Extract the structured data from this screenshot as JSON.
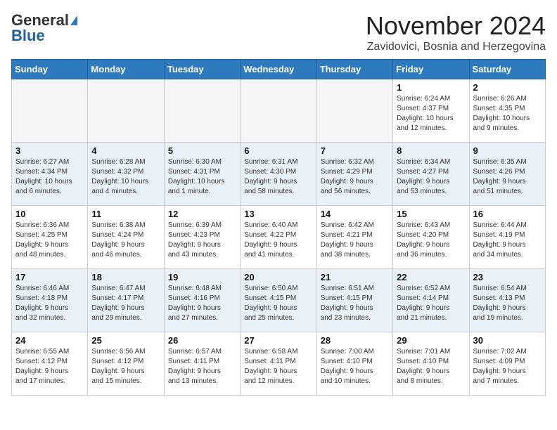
{
  "header": {
    "logo_general": "General",
    "logo_blue": "Blue",
    "month_title": "November 2024",
    "location": "Zavidovici, Bosnia and Herzegovina"
  },
  "weekdays": [
    "Sunday",
    "Monday",
    "Tuesday",
    "Wednesday",
    "Thursday",
    "Friday",
    "Saturday"
  ],
  "weeks": [
    [
      {
        "day": "",
        "info": ""
      },
      {
        "day": "",
        "info": ""
      },
      {
        "day": "",
        "info": ""
      },
      {
        "day": "",
        "info": ""
      },
      {
        "day": "",
        "info": ""
      },
      {
        "day": "1",
        "info": "Sunrise: 6:24 AM\nSunset: 4:37 PM\nDaylight: 10 hours\nand 12 minutes."
      },
      {
        "day": "2",
        "info": "Sunrise: 6:26 AM\nSunset: 4:35 PM\nDaylight: 10 hours\nand 9 minutes."
      }
    ],
    [
      {
        "day": "3",
        "info": "Sunrise: 6:27 AM\nSunset: 4:34 PM\nDaylight: 10 hours\nand 6 minutes."
      },
      {
        "day": "4",
        "info": "Sunrise: 6:28 AM\nSunset: 4:32 PM\nDaylight: 10 hours\nand 4 minutes."
      },
      {
        "day": "5",
        "info": "Sunrise: 6:30 AM\nSunset: 4:31 PM\nDaylight: 10 hours\nand 1 minute."
      },
      {
        "day": "6",
        "info": "Sunrise: 6:31 AM\nSunset: 4:30 PM\nDaylight: 9 hours\nand 58 minutes."
      },
      {
        "day": "7",
        "info": "Sunrise: 6:32 AM\nSunset: 4:29 PM\nDaylight: 9 hours\nand 56 minutes."
      },
      {
        "day": "8",
        "info": "Sunrise: 6:34 AM\nSunset: 4:27 PM\nDaylight: 9 hours\nand 53 minutes."
      },
      {
        "day": "9",
        "info": "Sunrise: 6:35 AM\nSunset: 4:26 PM\nDaylight: 9 hours\nand 51 minutes."
      }
    ],
    [
      {
        "day": "10",
        "info": "Sunrise: 6:36 AM\nSunset: 4:25 PM\nDaylight: 9 hours\nand 48 minutes."
      },
      {
        "day": "11",
        "info": "Sunrise: 6:38 AM\nSunset: 4:24 PM\nDaylight: 9 hours\nand 46 minutes."
      },
      {
        "day": "12",
        "info": "Sunrise: 6:39 AM\nSunset: 4:23 PM\nDaylight: 9 hours\nand 43 minutes."
      },
      {
        "day": "13",
        "info": "Sunrise: 6:40 AM\nSunset: 4:22 PM\nDaylight: 9 hours\nand 41 minutes."
      },
      {
        "day": "14",
        "info": "Sunrise: 6:42 AM\nSunset: 4:21 PM\nDaylight: 9 hours\nand 38 minutes."
      },
      {
        "day": "15",
        "info": "Sunrise: 6:43 AM\nSunset: 4:20 PM\nDaylight: 9 hours\nand 36 minutes."
      },
      {
        "day": "16",
        "info": "Sunrise: 6:44 AM\nSunset: 4:19 PM\nDaylight: 9 hours\nand 34 minutes."
      }
    ],
    [
      {
        "day": "17",
        "info": "Sunrise: 6:46 AM\nSunset: 4:18 PM\nDaylight: 9 hours\nand 32 minutes."
      },
      {
        "day": "18",
        "info": "Sunrise: 6:47 AM\nSunset: 4:17 PM\nDaylight: 9 hours\nand 29 minutes."
      },
      {
        "day": "19",
        "info": "Sunrise: 6:48 AM\nSunset: 4:16 PM\nDaylight: 9 hours\nand 27 minutes."
      },
      {
        "day": "20",
        "info": "Sunrise: 6:50 AM\nSunset: 4:15 PM\nDaylight: 9 hours\nand 25 minutes."
      },
      {
        "day": "21",
        "info": "Sunrise: 6:51 AM\nSunset: 4:15 PM\nDaylight: 9 hours\nand 23 minutes."
      },
      {
        "day": "22",
        "info": "Sunrise: 6:52 AM\nSunset: 4:14 PM\nDaylight: 9 hours\nand 21 minutes."
      },
      {
        "day": "23",
        "info": "Sunrise: 6:54 AM\nSunset: 4:13 PM\nDaylight: 9 hours\nand 19 minutes."
      }
    ],
    [
      {
        "day": "24",
        "info": "Sunrise: 6:55 AM\nSunset: 4:12 PM\nDaylight: 9 hours\nand 17 minutes."
      },
      {
        "day": "25",
        "info": "Sunrise: 6:56 AM\nSunset: 4:12 PM\nDaylight: 9 hours\nand 15 minutes."
      },
      {
        "day": "26",
        "info": "Sunrise: 6:57 AM\nSunset: 4:11 PM\nDaylight: 9 hours\nand 13 minutes."
      },
      {
        "day": "27",
        "info": "Sunrise: 6:58 AM\nSunset: 4:11 PM\nDaylight: 9 hours\nand 12 minutes."
      },
      {
        "day": "28",
        "info": "Sunrise: 7:00 AM\nSunset: 4:10 PM\nDaylight: 9 hours\nand 10 minutes."
      },
      {
        "day": "29",
        "info": "Sunrise: 7:01 AM\nSunset: 4:10 PM\nDaylight: 9 hours\nand 8 minutes."
      },
      {
        "day": "30",
        "info": "Sunrise: 7:02 AM\nSunset: 4:09 PM\nDaylight: 9 hours\nand 7 minutes."
      }
    ]
  ]
}
